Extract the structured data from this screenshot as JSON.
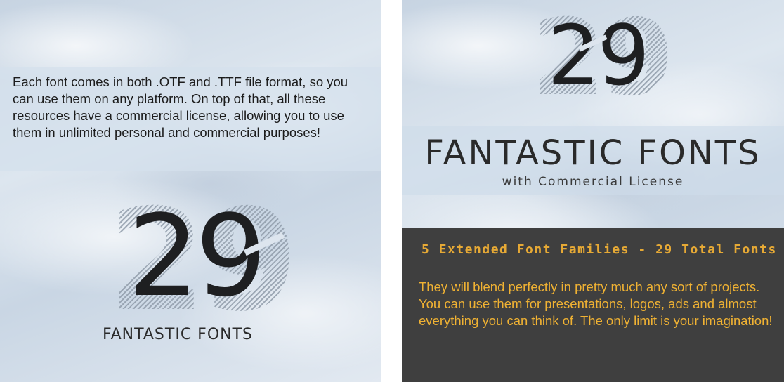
{
  "left": {
    "intro": "Each font comes in both .OTF and .TTF file format, so you can use them on any platform. On top of that, all these resources have a commercial license, allowing you to use them in unlimited personal and commercial purposes!",
    "number": "29",
    "brand": "FANTASTIC FONTS"
  },
  "right": {
    "number": "29",
    "title": "FANTASTIC FONTS",
    "subtitle": "with Commercial License",
    "families": "5 Extended Font Families - 29 Total Fonts",
    "description": "They will blend perfectly in pretty much any sort of projects. You can use them for presentations, logos, ads and almost everything you can think of. The only limit is your imagination!"
  },
  "colors": {
    "accent": "#f0b233",
    "dark_box": "#3f3f3f",
    "text_dark": "#1e1f21"
  }
}
